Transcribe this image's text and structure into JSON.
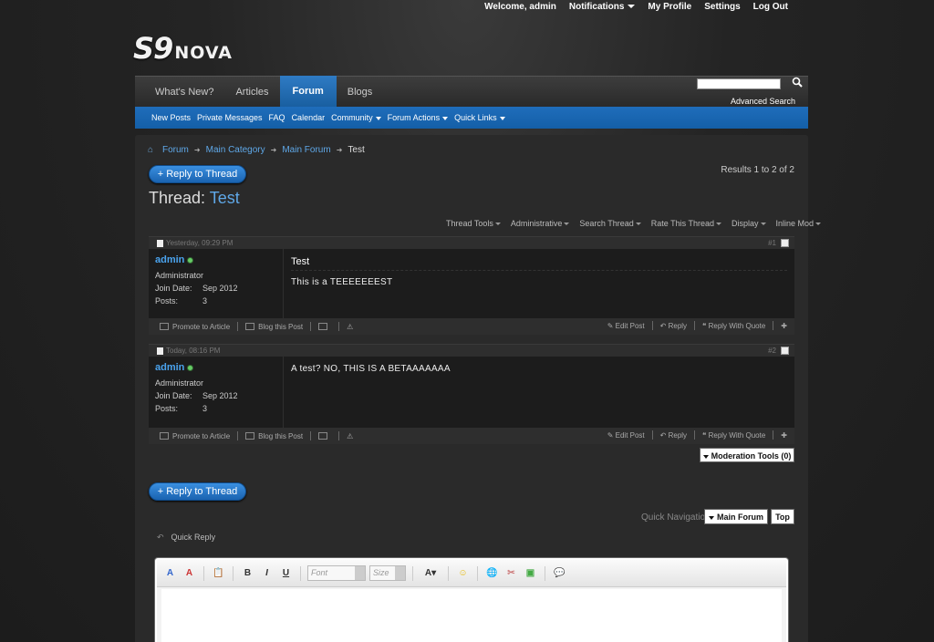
{
  "topbar": {
    "welcome": "Welcome,",
    "username": "admin",
    "notifications": "Notifications",
    "profile": "My Profile",
    "settings": "Settings",
    "logout": "Log Out"
  },
  "logo": {
    "main": "S9",
    "sub": "NOVA"
  },
  "nav": {
    "tabs": [
      "What's New?",
      "Articles",
      "Forum",
      "Blogs"
    ],
    "advanced_search": "Advanced Search"
  },
  "subnav": {
    "items": [
      "New Posts",
      "Private Messages",
      "FAQ",
      "Calendar",
      "Community",
      "Forum Actions",
      "Quick Links"
    ]
  },
  "breadcrumb": {
    "items": [
      "Forum",
      "Main Category",
      "Main Forum"
    ],
    "current": "Test"
  },
  "reply_label": "+ Reply to Thread",
  "results": "Results 1 to 2 of 2",
  "thread": {
    "prefix": "Thread:",
    "name": "Test"
  },
  "tools": [
    "Thread Tools",
    "Administrative",
    "Search Thread",
    "Rate This Thread",
    "Display",
    "Inline Mod"
  ],
  "posts": [
    {
      "date": "Yesterday, 09:29 PM",
      "number": "#1",
      "username": "admin",
      "usertitle": "Administrator",
      "join_label": "Join Date:",
      "join_value": "Sep 2012",
      "posts_label": "Posts:",
      "posts_value": "3",
      "title": "Test",
      "text": "This is a TEEEEEEEST"
    },
    {
      "date": "Today, 08:16 PM",
      "number": "#2",
      "username": "admin",
      "usertitle": "Administrator",
      "join_label": "Join Date:",
      "join_value": "Sep 2012",
      "posts_label": "Posts:",
      "posts_value": "3",
      "title": "",
      "text": "A test? NO, THIS IS A BETAAAAAAA"
    }
  ],
  "post_actions": {
    "promote": "Promote to Article",
    "blog": "Blog this Post",
    "edit": "Edit Post",
    "reply": "Reply",
    "reply_quote": "Reply With Quote"
  },
  "moderation_tools": "Moderation Tools (0)",
  "quick_nav": {
    "label": "Quick Navigation",
    "forum": "Main Forum",
    "top": "Top"
  },
  "quick_reply": "Quick Reply",
  "editor": {
    "font": "Font",
    "size": "Size"
  }
}
